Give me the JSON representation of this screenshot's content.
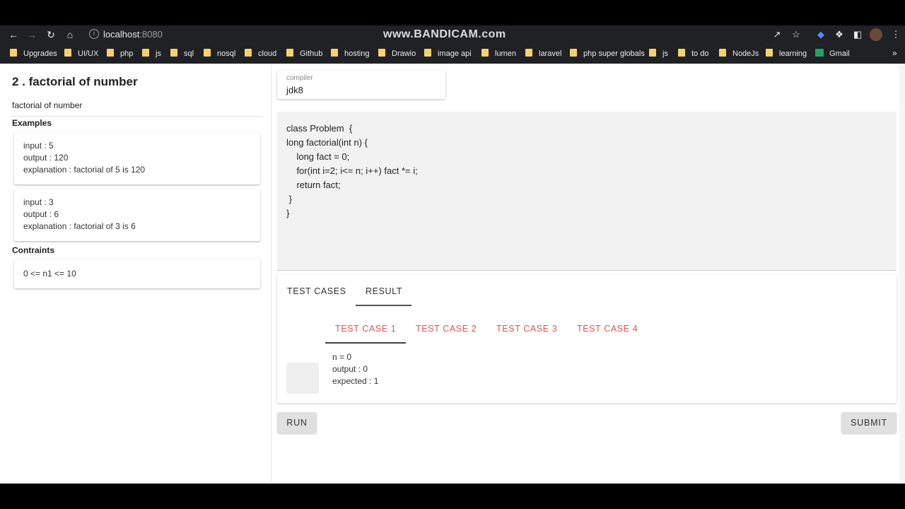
{
  "browser": {
    "url_host": "localhost",
    "url_port": ":8080",
    "watermark": "www.BANDICAM.com",
    "bookmarks": [
      "Upgrades",
      "UI/UX",
      "php",
      "js",
      "sql",
      "nosql",
      "cloud",
      "Github",
      "hosting",
      "Drawio",
      "image api",
      "lumen",
      "laravel",
      "php super globals",
      "js",
      "to do",
      "NodeJs",
      "learning",
      "Gmail"
    ]
  },
  "problem": {
    "title": "2 . factorial of number",
    "description": "factorial of number",
    "examples_heading": "Examples",
    "examples": [
      {
        "input": "input : 5",
        "output": "output : 120",
        "explanation": "explanation : factorial of 5 is 120"
      },
      {
        "input": "input : 3",
        "output": "output : 6",
        "explanation": "explanation : factorial of 3 is 6"
      }
    ],
    "constraints_heading": "Contraints",
    "constraint": "0 <= n1 <= 10"
  },
  "compiler": {
    "label": "compiler",
    "value": "jdk8"
  },
  "code": [
    "class Problem  {",
    "long factorial(int n) {",
    "    long fact = 0;",
    "    for(int i=2; i<= n; i++) fact *= i;",
    "    return fact;",
    " }",
    "}"
  ],
  "tabs": {
    "test_cases": "TEST CASES",
    "result": "RESULT"
  },
  "test_case_tabs": [
    "TEST CASE 1",
    "TEST CASE 2",
    "TEST CASE 3",
    "TEST CASE 4"
  ],
  "result": {
    "n": "n = 0",
    "output": "output : 0",
    "expected": "expected : 1"
  },
  "buttons": {
    "run": "RUN",
    "submit": "SUBMIT"
  },
  "colors": {
    "accent_red": "#e05252",
    "editor_bg": "#f2f2f2"
  }
}
